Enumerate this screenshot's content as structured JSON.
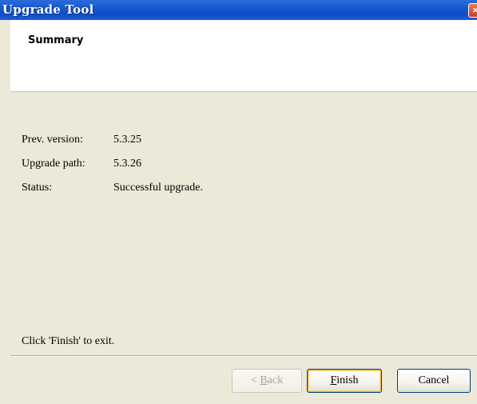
{
  "window": {
    "title": "Upgrade Tool",
    "close_glyph": "×"
  },
  "header": {
    "title": "Summary"
  },
  "details": [
    {
      "label": "Prev. version:",
      "value": "5.3.25"
    },
    {
      "label": "Upgrade path:",
      "value": "5.3.26"
    },
    {
      "label": "Status:",
      "value": "Successful upgrade."
    }
  ],
  "footer": {
    "hint": "Click 'Finish' to exit."
  },
  "buttons": {
    "back_prefix": "< ",
    "back_accel": "B",
    "back_rest": "ack",
    "finish_accel": "F",
    "finish_rest": "inish",
    "cancel": "Cancel"
  },
  "colors": {
    "titlebar": "#0c4ec6",
    "dialog_background": "#ECE9D8",
    "header_background": "#ffffff",
    "default_button_highlight": "#f8b33a"
  }
}
